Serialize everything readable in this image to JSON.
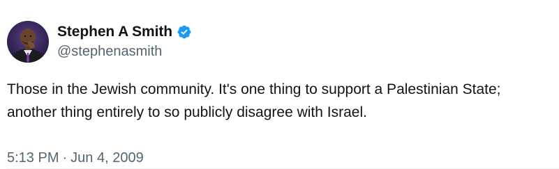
{
  "author": {
    "display_name": "Stephen A Smith",
    "handle": "@stephenasmith",
    "verified": true,
    "verified_color": "#1d9bf0",
    "avatar_icon": "profile-photo"
  },
  "tweet": {
    "text_lines": [
      "Those in the Jewish community. It's one thing to support a Palestinian State;",
      "another thing entirely to so publicly disagree with Israel."
    ],
    "time": "5:13 PM",
    "separator": "·",
    "date": "Jun 4, 2009"
  },
  "colors": {
    "text_primary": "#0f1419",
    "text_secondary": "#536471",
    "divider": "#eff3f4"
  }
}
